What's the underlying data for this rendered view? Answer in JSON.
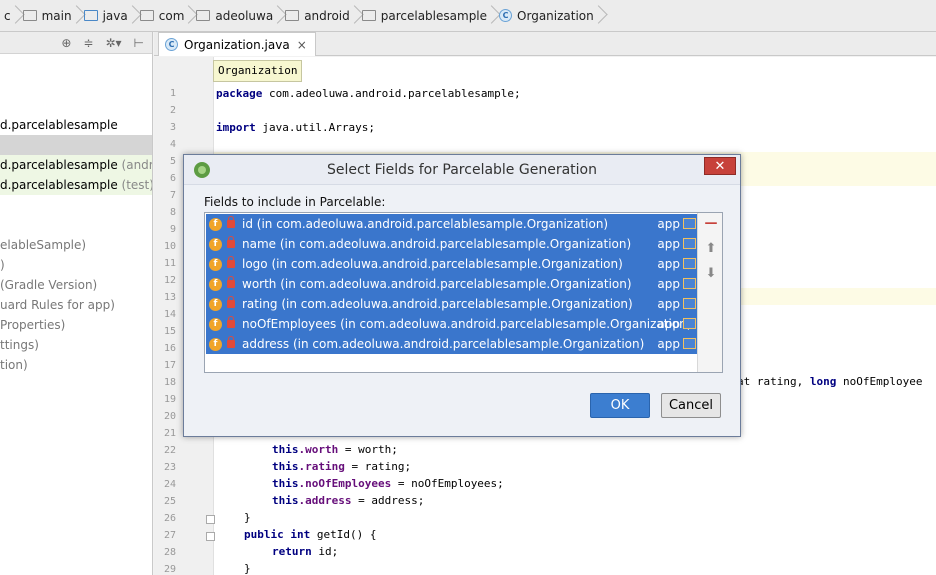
{
  "breadcrumb": [
    {
      "label": "c",
      "icon": "none"
    },
    {
      "label": "main",
      "icon": "folder-icon"
    },
    {
      "label": "java",
      "icon": "blue-folder-icon"
    },
    {
      "label": "com",
      "icon": "folder-icon"
    },
    {
      "label": "adeoluwa",
      "icon": "folder-icon"
    },
    {
      "label": "android",
      "icon": "folder-icon"
    },
    {
      "label": "parcelablesample",
      "icon": "folder-icon"
    },
    {
      "label": "Organization",
      "icon": "class-icon"
    }
  ],
  "left_panel": {
    "toolbar_icons": [
      "target-icon",
      "collapse-icon",
      "gear-icon",
      "hide-icon"
    ],
    "items": [
      {
        "label": "d.parcelablesample",
        "suffix": ""
      },
      {
        "label": "",
        "suffix": ""
      },
      {
        "label": "d.parcelablesample",
        "suffix": "(androidT"
      },
      {
        "label": "d.parcelablesample",
        "suffix": "(test)"
      },
      {
        "label": "elableSample)",
        "suffix": ""
      },
      {
        "label": ")",
        "suffix": ""
      },
      {
        "label": "(Gradle Version)",
        "suffix": ""
      },
      {
        "label": "uard Rules for app)",
        "suffix": ""
      },
      {
        "label": "Properties)",
        "suffix": ""
      },
      {
        "label": "ttings)",
        "suffix": ""
      },
      {
        "label": "tion)",
        "suffix": ""
      }
    ]
  },
  "editor": {
    "tab_label": "Organization.java",
    "tab_close": "×",
    "tab_icon_letter": "C",
    "tooltip": "Organization",
    "line_numbers": [
      "1",
      "2",
      "3",
      "4",
      "5",
      "6",
      "7",
      "8",
      "9",
      "10",
      "11",
      "12",
      "13",
      "14",
      "15",
      "16",
      "17",
      "18",
      "19",
      "20",
      "21",
      "22",
      "23",
      "24",
      "25",
      "26",
      "27",
      "28",
      "29"
    ],
    "line1_kw": "package",
    "line1_rest": " com.adeoluwa.android.parcelablesample;",
    "line3_kw": "import",
    "line3_rest": " java.util.Arrays;",
    "line18_a": "at rating, ",
    "line18_kw": "long",
    "line18_b": " noOfEmployee",
    "line22_kw": "this",
    "line22_f": ".worth",
    "line22_r": " = worth;",
    "line23_kw": "this",
    "line23_f": ".rating",
    "line23_r": " = rating;",
    "line24_kw": "this",
    "line24_f": ".noOfEmployees",
    "line24_r": " = noOfEmployees;",
    "line25_kw": "this",
    "line25_f": ".address",
    "line25_r": " = address;",
    "line26": "}",
    "line27_kw1": "public",
    "line27_kw2": "int",
    "line27_r": " getId() {",
    "line28_kw": "return",
    "line28_r": " id;",
    "line29": "}"
  },
  "dialog": {
    "title": "Select Fields for Parcelable Generation",
    "close_label": "✕",
    "list_label": "Fields to include in Parcelable:",
    "fields": [
      {
        "text": "id (in com.adeoluwa.android.parcelablesample.Organization)",
        "module": "app"
      },
      {
        "text": "name (in com.adeoluwa.android.parcelablesample.Organization)",
        "module": "app"
      },
      {
        "text": "logo (in com.adeoluwa.android.parcelablesample.Organization)",
        "module": "app"
      },
      {
        "text": "worth (in com.adeoluwa.android.parcelablesample.Organization)",
        "module": "app"
      },
      {
        "text": "rating (in com.adeoluwa.android.parcelablesample.Organization)",
        "module": "app"
      },
      {
        "text": "noOfEmployees (in com.adeoluwa.android.parcelablesample.Organization)",
        "module": "app"
      },
      {
        "text": "address (in com.adeoluwa.android.parcelablesample.Organization)",
        "module": "app"
      }
    ],
    "field_icon_letter": "f",
    "ok_label": "OK",
    "cancel_label": "Cancel",
    "colors": {
      "selection": "#3a76cc",
      "ok": "#3c7ed0",
      "close": "#c7413a"
    }
  }
}
